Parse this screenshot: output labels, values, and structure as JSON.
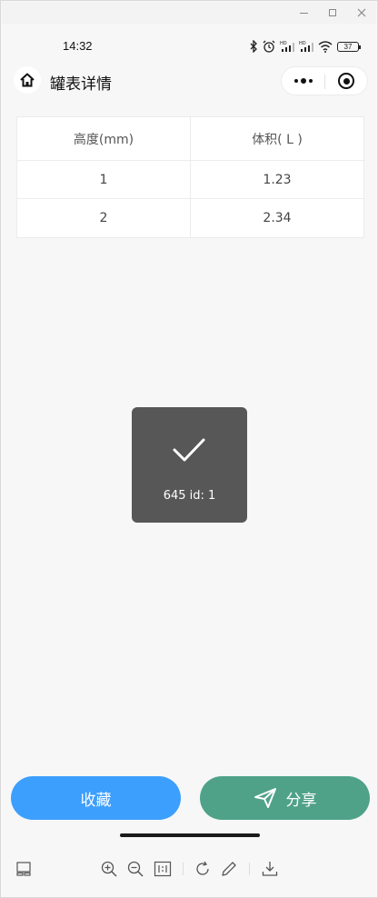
{
  "status_bar": {
    "time": "14:32",
    "battery": "37",
    "icons": [
      "bluetooth-icon",
      "alarm-icon",
      "hd-signal-icon",
      "hd-signal-icon",
      "wifi-icon",
      "battery-icon"
    ]
  },
  "nav": {
    "title": "罐表详情"
  },
  "table": {
    "headers": [
      "高度(mm)",
      "体积( L )"
    ],
    "rows": [
      [
        "1",
        "1.23"
      ],
      [
        "2",
        "2.34"
      ]
    ]
  },
  "toast": {
    "message": "645 id: 1"
  },
  "actions": {
    "favorite_label": "收藏",
    "share_label": "分享"
  },
  "colors": {
    "favorite": "#3d9ffd",
    "share": "#4fa288",
    "toast_bg": "#575757"
  }
}
